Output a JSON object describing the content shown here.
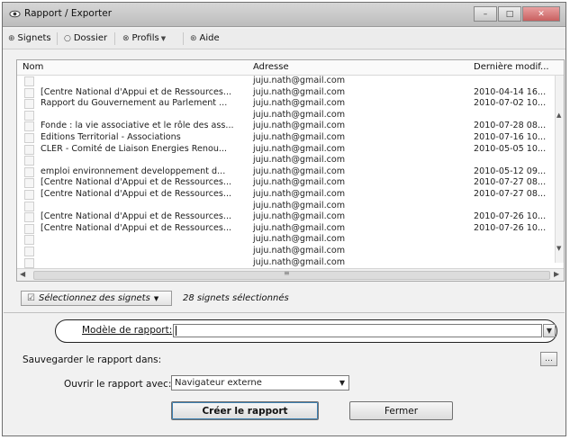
{
  "window": {
    "title": "Rapport / Exporter",
    "controls": {
      "minimize": "–",
      "maximize": "□",
      "close": "✕"
    }
  },
  "toolbar": {
    "bookmarks_label": "Signets",
    "folder_label": "Dossier",
    "profiles_label": "Profils",
    "help_label": "Aide"
  },
  "list": {
    "columns": {
      "name": "Nom",
      "address": "Adresse",
      "modified": "Dernière modif..."
    },
    "rows": [
      {
        "name": "",
        "address": "juju.nath@gmail.com",
        "modified": ""
      },
      {
        "name": "[Centre National d'Appui et de Ressources...",
        "address": "juju.nath@gmail.com",
        "modified": "2010-04-14 16..."
      },
      {
        "name": "Rapport du Gouvernement au Parlement ...",
        "address": "juju.nath@gmail.com",
        "modified": "2010-07-02 10..."
      },
      {
        "name": "",
        "address": "juju.nath@gmail.com",
        "modified": ""
      },
      {
        "name": "Fonde : la vie associative et le rôle des ass...",
        "address": "juju.nath@gmail.com",
        "modified": "2010-07-28 08..."
      },
      {
        "name": "Editions Territorial - Associations",
        "address": "juju.nath@gmail.com",
        "modified": "2010-07-16 10..."
      },
      {
        "name": "CLER - Comité de Liaison Energies Renou...",
        "address": "juju.nath@gmail.com",
        "modified": "2010-05-05 10..."
      },
      {
        "name": "",
        "address": "juju.nath@gmail.com",
        "modified": ""
      },
      {
        "name": "emploi environnement developpement d...",
        "address": "juju.nath@gmail.com",
        "modified": "2010-05-12 09..."
      },
      {
        "name": "[Centre National d'Appui et de Ressources...",
        "address": "juju.nath@gmail.com",
        "modified": "2010-07-27 08..."
      },
      {
        "name": "[Centre National d'Appui et de Ressources...",
        "address": "juju.nath@gmail.com",
        "modified": "2010-07-27 08..."
      },
      {
        "name": "",
        "address": "juju.nath@gmail.com",
        "modified": ""
      },
      {
        "name": "[Centre National d'Appui et de Ressources...",
        "address": "juju.nath@gmail.com",
        "modified": "2010-07-26 10..."
      },
      {
        "name": "[Centre National d'Appui et de Ressources...",
        "address": "juju.nath@gmail.com",
        "modified": "2010-07-26 10..."
      },
      {
        "name": "",
        "address": "juju.nath@gmail.com",
        "modified": ""
      },
      {
        "name": "",
        "address": "juju.nath@gmail.com",
        "modified": ""
      },
      {
        "name": "",
        "address": "juju.nath@gmail.com",
        "modified": ""
      }
    ]
  },
  "selection": {
    "button_label": "Sélectionnez des signets",
    "info": "28 signets sélectionnés"
  },
  "form": {
    "model_label": "Modèle de rapport:",
    "model_value": "",
    "save_label": "Sauvegarder le rapport dans:",
    "open_label": "Ouvrir le rapport avec:",
    "open_value": "Navigateur externe"
  },
  "actions": {
    "create_label": "Créer le rapport",
    "close_label": "Fermer"
  },
  "icons": {
    "app": "eye-icon",
    "bookmarks": "bookmark-icon",
    "profiles": "profile-icon",
    "help": "help-icon",
    "select": "checkbox-icon"
  }
}
